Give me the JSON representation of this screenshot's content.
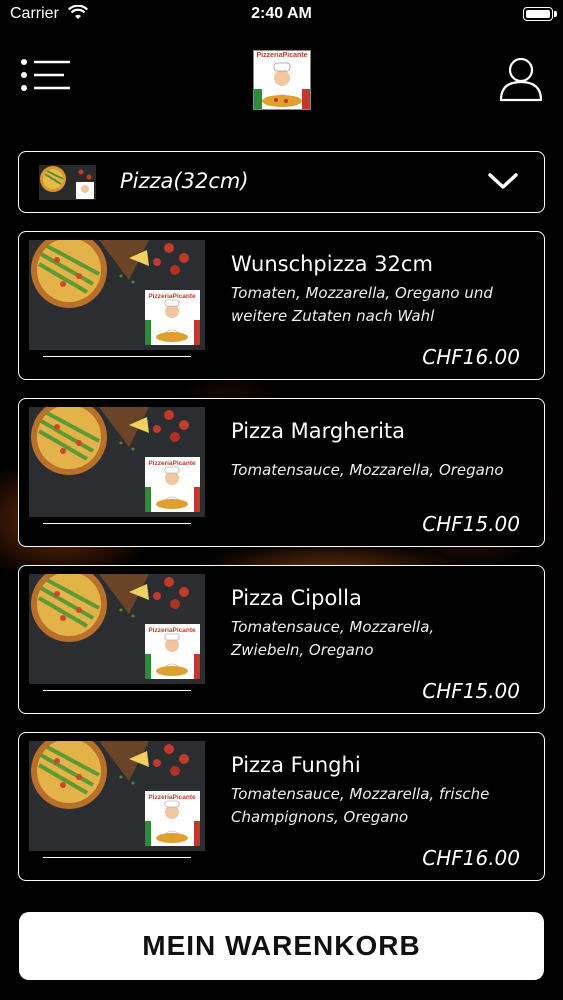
{
  "status_bar": {
    "carrier": "Carrier",
    "time": "2:40 AM"
  },
  "header": {
    "menu_icon": "list-menu-icon",
    "logo_text": "PizzeriaPicante",
    "user_icon": "user-icon"
  },
  "category": {
    "label": "Pizza(32cm)",
    "chevron_icon": "chevron-down-icon"
  },
  "products": [
    {
      "name": "Wunschpizza 32cm",
      "description_lines": [
        "Tomaten, Mozzarella, Oregano und",
        "weitere Zutaten nach Wahl"
      ],
      "price": "CHF16.00"
    },
    {
      "name": "Pizza Margherita",
      "description_lines": [
        "Tomatensauce, Mozzarella, Oregano"
      ],
      "price": "CHF15.00"
    },
    {
      "name": "Pizza Cipolla",
      "description_lines": [
        "Tomatensauce, Mozzarella,",
        "Zwiebeln, Oregano"
      ],
      "price": "CHF15.00"
    },
    {
      "name": "Pizza Funghi",
      "description_lines": [
        "Tomatensauce, Mozzarella, frische",
        "Champignons, Oregano"
      ],
      "price": "CHF16.00"
    }
  ],
  "cart_button": {
    "label": "MEIN WARENKORB"
  },
  "colors": {
    "background": "#000000",
    "border": "#ffffff",
    "cart_button_bg": "#ffffff",
    "logo_red": "#c0392b"
  }
}
